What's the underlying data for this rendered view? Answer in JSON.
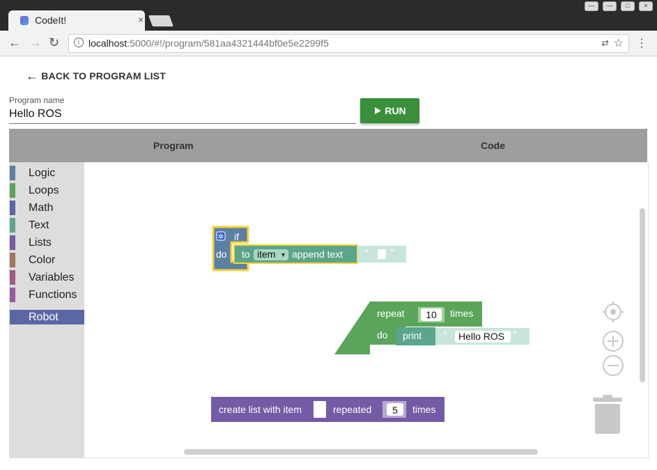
{
  "browser": {
    "tab_title": "CodeIt!",
    "tab_close": "×",
    "url_host": "localhost",
    "url_rest": ":5000/#!/program/581aa4321444bf0e5e2299f5",
    "window_buttons": [
      "—",
      "—",
      "□",
      "×"
    ]
  },
  "page": {
    "back_label": "BACK TO PROGRAM LIST",
    "program_name_label": "Program name",
    "program_name_value": "Hello ROS",
    "run_label": "RUN",
    "tabs": [
      "Program",
      "Code"
    ]
  },
  "toolbox": {
    "categories": [
      {
        "label": "Logic",
        "color": "#5b80a5"
      },
      {
        "label": "Loops",
        "color": "#5ba55b"
      },
      {
        "label": "Math",
        "color": "#5b67a5"
      },
      {
        "label": "Text",
        "color": "#5ba58c"
      },
      {
        "label": "Lists",
        "color": "#745ba5"
      },
      {
        "label": "Color",
        "color": "#a5745b"
      },
      {
        "label": "Variables",
        "color": "#a55b80"
      },
      {
        "label": "Functions",
        "color": "#995ba5"
      },
      {
        "label": "Robot",
        "color": "#5b67a5",
        "selected": true
      }
    ]
  },
  "blocks": {
    "if_block": {
      "if": "if",
      "do": "do"
    },
    "append_block": {
      "to": "to",
      "variable": "item",
      "append": "append text",
      "quote_open": "“",
      "quote_close": "”"
    },
    "repeat_block": {
      "repeat": "repeat",
      "count": "10",
      "times": "times",
      "do": "do"
    },
    "print_block": {
      "print": "print",
      "text": "Hello ROS",
      "quote_open": "“",
      "quote_close": "”"
    },
    "list_block": {
      "create": "create list with item",
      "repeated": "repeated",
      "count": "5",
      "times": "times"
    }
  },
  "colors": {
    "logic": "#5b80a5",
    "loops": "#5ba55b",
    "text": "#5ba58c",
    "lists": "#745ba5",
    "highlight": "#f7d233",
    "run_button": "#3a8f3a"
  },
  "icons": [
    "back-arrow-icon",
    "play-icon",
    "target-icon",
    "zoom-in-icon",
    "zoom-out-icon",
    "trash-icon",
    "gear-icon"
  ]
}
